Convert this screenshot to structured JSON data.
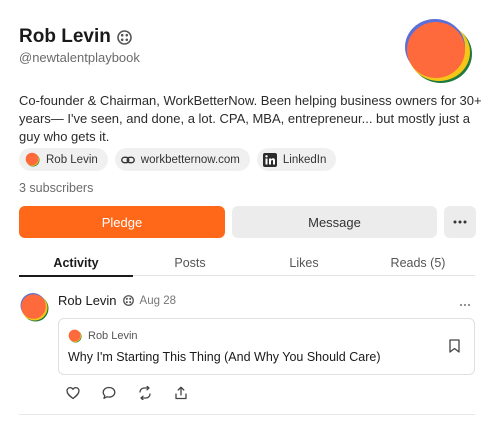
{
  "profile": {
    "name": "Rob Levin",
    "handle": "@newtalentplaybook",
    "bio": "Co-founder & Chairman, WorkBetterNow. Been helping business owners for 30+ years— I've seen, and done, a lot. CPA, MBA, entrepreneur... but mostly just a guy who gets it.",
    "subscribers": "3 subscribers"
  },
  "links": [
    {
      "label": "Rob Levin",
      "icon": "avatar-icon"
    },
    {
      "label": "workbetternow.com",
      "icon": "link-icon"
    },
    {
      "label": "LinkedIn",
      "icon": "linkedin-icon"
    }
  ],
  "buttons": {
    "pledge": "Pledge",
    "message": "Message",
    "more": "more-horizontal-icon"
  },
  "tabs": [
    {
      "label": "Activity",
      "active": true
    },
    {
      "label": "Posts"
    },
    {
      "label": "Likes"
    },
    {
      "label": "Reads (5)"
    }
  ],
  "post": {
    "author": "Rob Levin",
    "date": "Aug 28",
    "card": {
      "author": "Rob Levin",
      "title": "Why I'm Starting This Thing (And Why You Should Care)"
    },
    "actions": [
      "heart-icon",
      "comment-icon",
      "restack-icon",
      "share-icon"
    ]
  },
  "colors": {
    "accent": "#ff6719",
    "avatar_orange": "#ff6a3d",
    "avatar_green": "#1f7a3d",
    "avatar_yellow": "#f5c518",
    "avatar_blue": "#5b6fd8"
  }
}
